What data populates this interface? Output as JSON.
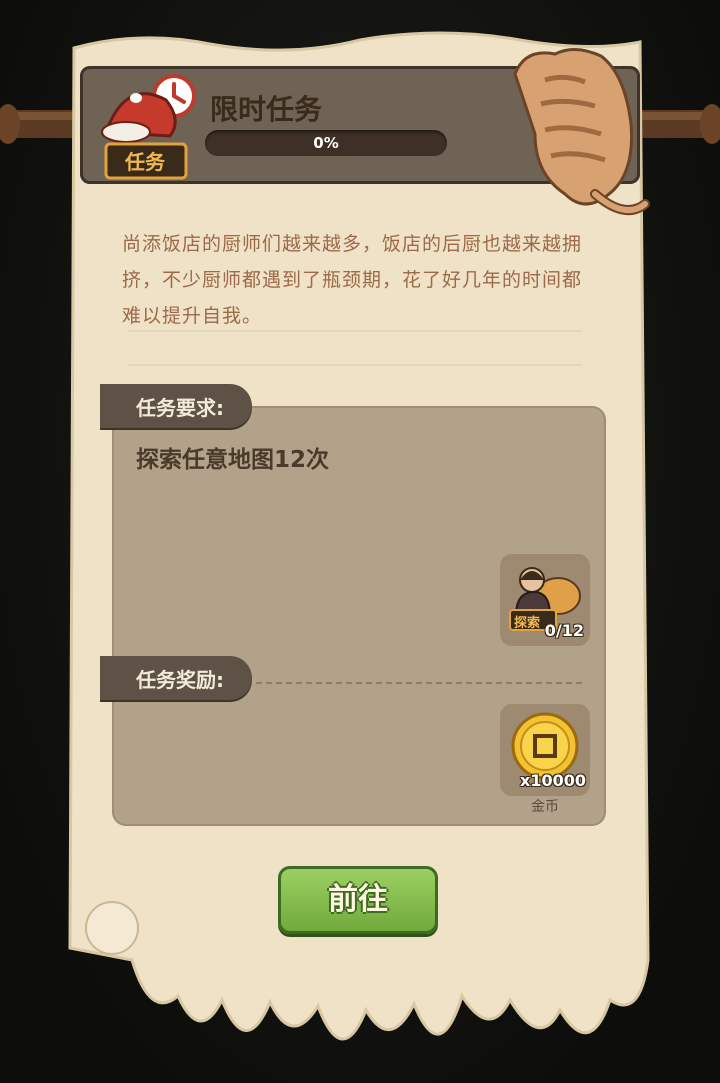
{
  "task": {
    "badge_label": "任务",
    "title": "限时任务",
    "progress_text": "0%",
    "progress_fraction": 0.0
  },
  "description": "尚添饭店的厨师们越来越多，饭店的后厨也越来越拥挤，不少厨师都遇到了瓶颈期，花了好几年的时间都难以提升自我。",
  "requirements": {
    "label": "任务要求:",
    "text": "探索任意地图12次",
    "item": {
      "icon": "explore-icon",
      "badge": "探索",
      "count": "0/12"
    }
  },
  "rewards": {
    "label": "任务奖励:",
    "item": {
      "icon": "gold-coin-icon",
      "amount": "x10000",
      "name": "金币"
    }
  },
  "go_button_label": "前往",
  "colors": {
    "parchment": "#efe2c6",
    "panel": "#b3a28a",
    "button_green": "#86bf4f",
    "header": "#6f6355"
  }
}
